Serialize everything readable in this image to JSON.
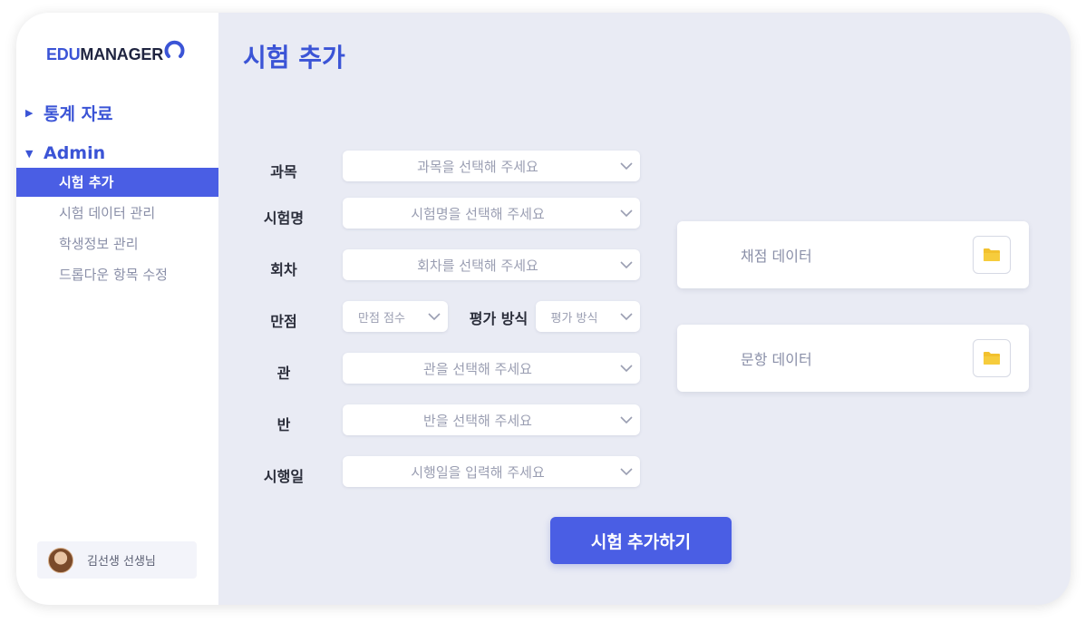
{
  "logo": {
    "part1": "EDU",
    "part2": "MANAGER"
  },
  "sidebar": {
    "groups": [
      {
        "label": "통계 자료",
        "expanded": false
      },
      {
        "label": "Admin",
        "expanded": true,
        "items": [
          {
            "label": "시험 추가",
            "active": true
          },
          {
            "label": "시험 데이터 관리",
            "active": false
          },
          {
            "label": "학생정보 관리",
            "active": false
          },
          {
            "label": "드롭다운 항목 수정",
            "active": false
          }
        ]
      }
    ],
    "user": {
      "name": "김선생 선생님"
    }
  },
  "page": {
    "title": "시험 추가"
  },
  "form": {
    "subject": {
      "label": "과목",
      "placeholder": "과목을 선택해 주세요"
    },
    "exam_name": {
      "label": "시험명",
      "placeholder": "시험명을 선택해 주세요"
    },
    "round": {
      "label": "회차",
      "placeholder": "회차를 선택해 주세요"
    },
    "full_score": {
      "label": "만점",
      "placeholder": "만점 점수"
    },
    "eval_method": {
      "label": "평가 방식",
      "placeholder": "평가 방식"
    },
    "hall": {
      "label": "관",
      "placeholder": "관을 선택해 주세요"
    },
    "class": {
      "label": "반",
      "placeholder": "반을 선택해 주세요"
    },
    "exam_date": {
      "label": "시행일",
      "placeholder": "시행일을 입력해 주세요"
    }
  },
  "uploads": {
    "grading": {
      "label": "채점 데이터",
      "icon": "folder-icon"
    },
    "items": {
      "label": "문항 데이터",
      "icon": "folder-icon"
    }
  },
  "submit_label": "시험 추가하기",
  "colors": {
    "accent": "#4a5ee4",
    "folder": "#f2c12e"
  }
}
